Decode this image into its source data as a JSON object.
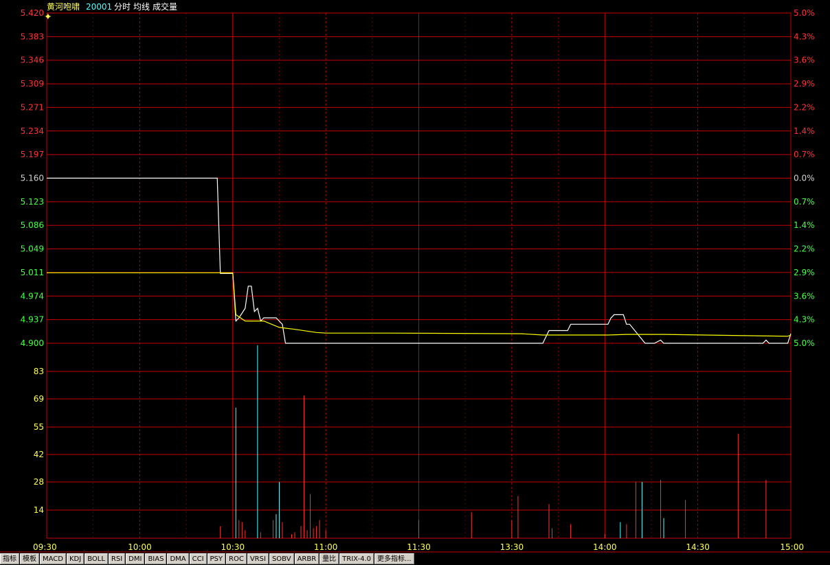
{
  "header": {
    "stock_name": "黄河咆啸",
    "stock_code": "20001",
    "items": [
      "分时",
      "均线",
      "成交量"
    ]
  },
  "chart_data": [
    {
      "type": "line",
      "title": "分时",
      "x_ticks": [
        "09:30",
        "10:00",
        "10:30",
        "11:00",
        "11:30",
        "13:30",
        "14:00",
        "14:30",
        "15:00"
      ],
      "y_ticks": [
        "5.420",
        "5.383",
        "5.346",
        "5.309",
        "5.271",
        "5.234",
        "5.197",
        "5.160",
        "5.123",
        "5.086",
        "5.049",
        "5.011",
        "4.974",
        "4.937",
        "4.900"
      ],
      "pct_ticks": [
        "5.0%",
        "4.3%",
        "3.6%",
        "2.9%",
        "2.2%",
        "1.4%",
        "0.7%",
        "0.0%",
        "0.7%",
        "1.4%",
        "2.2%",
        "2.9%",
        "3.6%",
        "4.3%",
        "5.0%"
      ],
      "ylim": [
        4.9,
        5.42
      ],
      "prev_close": 5.16,
      "minutes": 240,
      "series": [
        {
          "name": "分时",
          "color": "#ffffff",
          "points": [
            [
              0,
              5.16
            ],
            [
              55,
              5.16
            ],
            [
              56,
              5.01
            ],
            [
              60,
              5.01
            ],
            [
              61,
              4.935
            ],
            [
              62,
              4.94
            ],
            [
              64,
              4.955
            ],
            [
              65,
              4.99
            ],
            [
              66,
              4.99
            ],
            [
              67,
              4.95
            ],
            [
              68,
              4.955
            ],
            [
              69,
              4.935
            ],
            [
              70,
              4.94
            ],
            [
              74,
              4.94
            ],
            [
              76,
              4.93
            ],
            [
              77,
              4.9
            ],
            [
              160,
              4.9
            ],
            [
              162,
              4.92
            ],
            [
              168,
              4.92
            ],
            [
              169,
              4.93
            ],
            [
              176,
              4.93
            ],
            [
              181,
              4.93
            ],
            [
              182,
              4.94
            ],
            [
              183,
              4.945
            ],
            [
              186,
              4.945
            ],
            [
              187,
              4.93
            ],
            [
              188,
              4.93
            ],
            [
              193,
              4.9
            ],
            [
              196,
              4.9
            ],
            [
              198,
              4.905
            ],
            [
              199,
              4.9
            ],
            [
              231,
              4.9
            ],
            [
              232,
              4.905
            ],
            [
              233,
              4.9
            ],
            [
              239,
              4.9
            ],
            [
              240,
              4.915
            ]
          ]
        },
        {
          "name": "均线",
          "color": "#ffff00",
          "points": [
            [
              0,
              5.011
            ],
            [
              60,
              5.011
            ],
            [
              61,
              4.945
            ],
            [
              64,
              4.935
            ],
            [
              70,
              4.935
            ],
            [
              75,
              4.925
            ],
            [
              80,
              4.922
            ],
            [
              87,
              4.917
            ],
            [
              90,
              4.916
            ],
            [
              110,
              4.916
            ],
            [
              153,
              4.915
            ],
            [
              160,
              4.913
            ],
            [
              181,
              4.913
            ],
            [
              187,
              4.914
            ],
            [
              199,
              4.914
            ],
            [
              239,
              4.911
            ],
            [
              240,
              4.913
            ]
          ]
        }
      ]
    },
    {
      "type": "bar",
      "title": "成交量",
      "y_ticks": [
        "83",
        "69",
        "55",
        "42",
        "28",
        "14"
      ],
      "ylim": [
        0,
        97
      ],
      "bars": [
        {
          "m": 56,
          "v": 6,
          "c": "red"
        },
        {
          "m": 61,
          "v": 65,
          "c": "cyan"
        },
        {
          "m": 62,
          "v": 9,
          "c": "red"
        },
        {
          "m": 63,
          "v": 8,
          "c": "red"
        },
        {
          "m": 64,
          "v": 4,
          "c": "red"
        },
        {
          "m": 68,
          "v": 96,
          "c": "cyan"
        },
        {
          "m": 69,
          "v": 3,
          "c": "red"
        },
        {
          "m": 73,
          "v": 9,
          "c": "red"
        },
        {
          "m": 74,
          "v": 12,
          "c": "cyan"
        },
        {
          "m": 75,
          "v": 28,
          "c": "cyan"
        },
        {
          "m": 76,
          "v": 8,
          "c": "red"
        },
        {
          "m": 79,
          "v": 2,
          "c": "red"
        },
        {
          "m": 80,
          "v": 3,
          "c": "red"
        },
        {
          "m": 82,
          "v": 6,
          "c": "red"
        },
        {
          "m": 83,
          "v": 71,
          "c": "red"
        },
        {
          "m": 84,
          "v": 4,
          "c": "red"
        },
        {
          "m": 85,
          "v": 22,
          "c": "red"
        },
        {
          "m": 86,
          "v": 5,
          "c": "red"
        },
        {
          "m": 87,
          "v": 6,
          "c": "red"
        },
        {
          "m": 88,
          "v": 9,
          "c": "red"
        },
        {
          "m": 90,
          "v": 4,
          "c": "red"
        },
        {
          "m": 120,
          "v": 9,
          "c": "red"
        },
        {
          "m": 137,
          "v": 13,
          "c": "red"
        },
        {
          "m": 150,
          "v": 9,
          "c": "red"
        },
        {
          "m": 152,
          "v": 21,
          "c": "red"
        },
        {
          "m": 162,
          "v": 17,
          "c": "red"
        },
        {
          "m": 163,
          "v": 5,
          "c": "red"
        },
        {
          "m": 169,
          "v": 7,
          "c": "red"
        },
        {
          "m": 180,
          "v": 2,
          "c": "red"
        },
        {
          "m": 185,
          "v": 8,
          "c": "cyan"
        },
        {
          "m": 187,
          "v": 7,
          "c": "red"
        },
        {
          "m": 190,
          "v": 28,
          "c": "red"
        },
        {
          "m": 192,
          "v": 28,
          "c": "cyan"
        },
        {
          "m": 198,
          "v": 29,
          "c": "red"
        },
        {
          "m": 199,
          "v": 10,
          "c": "cyan"
        },
        {
          "m": 206,
          "v": 19,
          "c": "red"
        },
        {
          "m": 223,
          "v": 52,
          "c": "red"
        },
        {
          "m": 232,
          "v": 29,
          "c": "red"
        }
      ]
    }
  ],
  "toolbar": {
    "tabs": [
      "指标",
      "模板",
      "MACD",
      "KDJ",
      "BOLL",
      "RSI",
      "DMI",
      "BIAS",
      "DMA",
      "CCI",
      "PSY",
      "ROC",
      "VRSI",
      "SOBV",
      "ARBR",
      "量比",
      "TRIX-4.0",
      "更多指标..."
    ]
  },
  "colors": {
    "grid": "#c80000",
    "price_up": "#ff3232",
    "price_flat": "#d2d2d2",
    "price_down": "#46ff46",
    "volume_label": "#ffff55",
    "time_label": "#ffff55",
    "title_name": "#ffff55",
    "title_code": "#55ffff",
    "bar_up": "#ff3232",
    "bar_down": "#55ffff"
  }
}
